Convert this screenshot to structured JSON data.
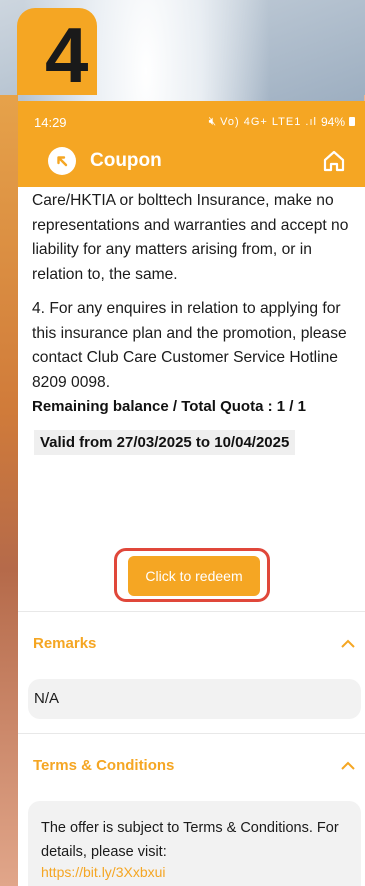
{
  "overlay": {
    "step_number": "4"
  },
  "status_bar": {
    "time": "14:29",
    "signal_text": "Vo) 4G+ LTE1 .ıl",
    "battery": "94%"
  },
  "app_bar": {
    "title": "Coupon",
    "back_icon": "back-arrow-icon",
    "home_icon": "home-icon"
  },
  "body": {
    "paragraphs": [
      "Care/HKTIA or bolttech Insurance, make no representations and warranties and accept no liability for any matters arising from, or in relation to, the same.",
      "4. For any enquires in relation to applying for this insurance plan and the promotion, please contact Club Care Customer Service Hotline 8209 0098."
    ],
    "remaining": "Remaining balance / Total Quota : 1 / 1",
    "valid": "Valid from 27/03/2025 to 10/04/2025"
  },
  "redeem_button": "Click to redeem",
  "remarks": {
    "heading": "Remarks",
    "value": "N/A"
  },
  "terms": {
    "heading": "Terms & Conditions",
    "text": "The offer is subject to Terms & Conditions. For details, please visit:",
    "link": "https://bit.ly/3Xxbxui"
  },
  "colors": {
    "accent": "#f5a623",
    "highlight": "#e0473a"
  }
}
